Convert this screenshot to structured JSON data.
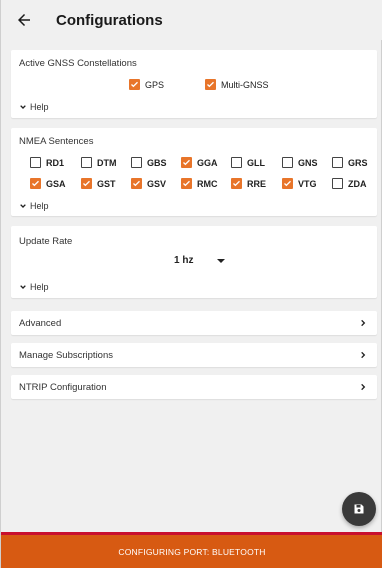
{
  "header": {
    "title": "Configurations"
  },
  "gnss": {
    "title": "Active GNSS Constellations",
    "options": [
      {
        "label": "GPS",
        "checked": true
      },
      {
        "label": "Multi-GNSS",
        "checked": true
      }
    ],
    "help": "Help"
  },
  "nmea": {
    "title": "NMEA Sentences",
    "options": [
      {
        "label": "RD1",
        "checked": false
      },
      {
        "label": "DTM",
        "checked": false
      },
      {
        "label": "GBS",
        "checked": false
      },
      {
        "label": "GGA",
        "checked": true
      },
      {
        "label": "GLL",
        "checked": false
      },
      {
        "label": "GNS",
        "checked": false
      },
      {
        "label": "GRS",
        "checked": false
      },
      {
        "label": "GSA",
        "checked": true
      },
      {
        "label": "GST",
        "checked": true
      },
      {
        "label": "GSV",
        "checked": true
      },
      {
        "label": "RMC",
        "checked": true
      },
      {
        "label": "RRE",
        "checked": true
      },
      {
        "label": "VTG",
        "checked": true
      },
      {
        "label": "ZDA",
        "checked": false
      }
    ],
    "help": "Help"
  },
  "update_rate": {
    "title": "Update Rate",
    "value": "1 hz",
    "help": "Help"
  },
  "rows": [
    {
      "label": "Advanced"
    },
    {
      "label": "Manage Subscriptions"
    },
    {
      "label": "NTRIP Configuration"
    }
  ],
  "footer": {
    "status": "CONFIGURING PORT: BLUETOOTH"
  },
  "colors": {
    "accent": "#e8752a",
    "bar": "#d75a12",
    "bar_border": "#c8102e",
    "fab": "#3a3a3a"
  },
  "icons": {
    "back": "arrow-left-icon",
    "help": "chevron-down-icon",
    "row": "chevron-right-icon",
    "fab": "save-icon",
    "check": "check-icon"
  }
}
